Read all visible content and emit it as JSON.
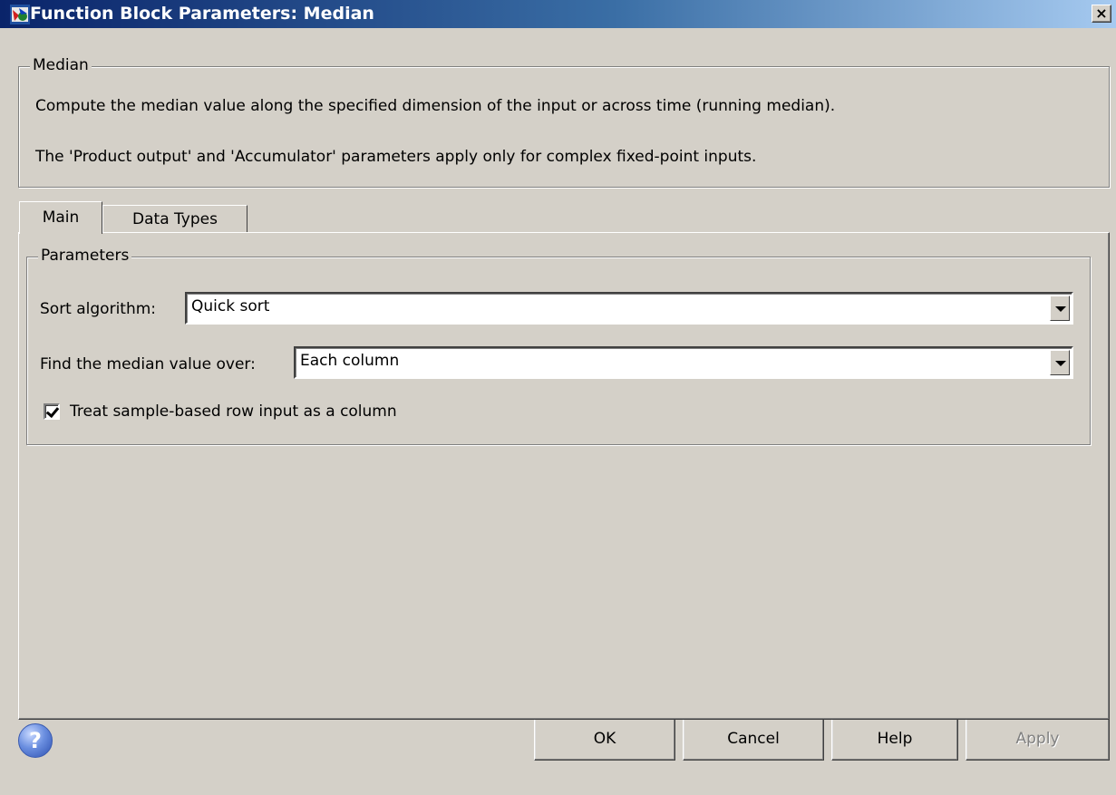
{
  "window": {
    "title": "Function Block Parameters: Median",
    "close_glyph": "×"
  },
  "description": {
    "group_label": "Median",
    "line1": "Compute the median value along the specified dimension of the input or across time (running median).",
    "line2": "The 'Product output' and 'Accumulator' parameters apply only for complex fixed-point inputs."
  },
  "tabs": [
    {
      "label": "Main",
      "active": true
    },
    {
      "label": "Data Types",
      "active": false
    }
  ],
  "parameters": {
    "group_label": "Parameters",
    "sort_algorithm": {
      "label": "Sort algorithm:",
      "value": "Quick sort"
    },
    "median_over": {
      "label": "Find the median value over:",
      "value": "Each column"
    },
    "treat_row_as_column": {
      "label": "Treat sample-based row input as a column",
      "checked": true
    }
  },
  "buttons": {
    "help_icon": "?",
    "ok": "OK",
    "cancel": "Cancel",
    "help": "Help",
    "apply": "Apply"
  }
}
